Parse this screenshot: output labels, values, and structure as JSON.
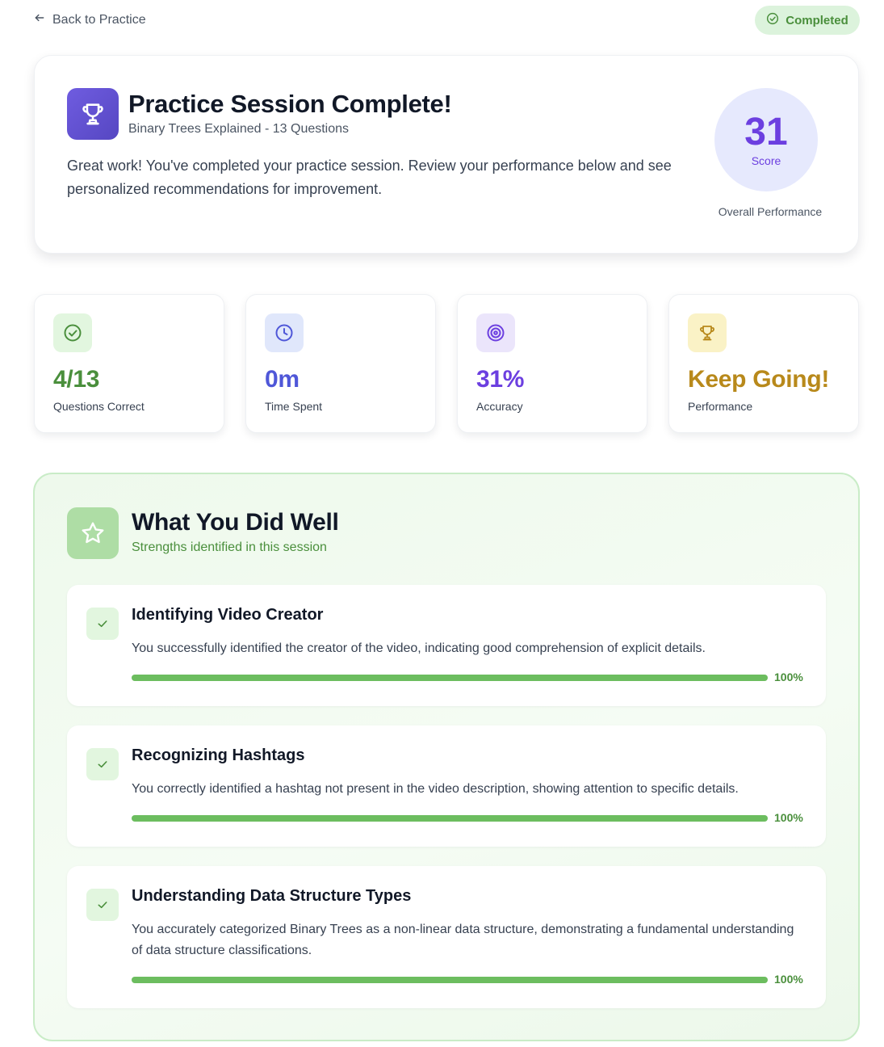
{
  "header": {
    "back_label": "Back to Practice",
    "back_icon": "arrow-left-icon",
    "status_label": "Completed",
    "status_icon": "check-circle-icon"
  },
  "hero": {
    "icon": "trophy-icon",
    "title": "Practice Session Complete!",
    "subtitle": "Binary Trees Explained - 13 Questions",
    "description": "Great work! You've completed your practice session. Review your performance below and see personalized recommendations for improvement.",
    "score_value": "31",
    "score_label": "Score",
    "score_caption": "Overall Performance"
  },
  "stats": [
    {
      "icon": "check-circle-icon",
      "value": "4/13",
      "label": "Questions Correct",
      "color": "#4a8f3c",
      "icon_bg": "#e2f6df"
    },
    {
      "icon": "clock-icon",
      "value": "0m",
      "label": "Time Spent",
      "color": "#4f57d8",
      "icon_bg": "#e0e7fb"
    },
    {
      "icon": "target-icon",
      "value": "31%",
      "label": "Accuracy",
      "color": "#6c3fe0",
      "icon_bg": "#ebe5fb"
    },
    {
      "icon": "trophy-icon",
      "value": "Keep Going!",
      "label": "Performance",
      "color": "#b8891b",
      "icon_bg": "#faf2c6"
    }
  ],
  "strengths": {
    "icon": "star-icon",
    "title": "What You Did Well",
    "subtitle": "Strengths identified in this session",
    "items": [
      {
        "title": "Identifying Video Creator",
        "description": "You successfully identified the creator of the video, indicating good comprehension of explicit details.",
        "progress": 100,
        "progress_label": "100%"
      },
      {
        "title": "Recognizing Hashtags",
        "description": "You correctly identified a hashtag not present in the video description, showing attention to specific details.",
        "progress": 100,
        "progress_label": "100%"
      },
      {
        "title": "Understanding Data Structure Types",
        "description": "You accurately categorized Binary Trees as a non-linear data structure, demonstrating a fundamental understanding of data structure classifications.",
        "progress": 100,
        "progress_label": "100%"
      }
    ]
  },
  "colors": {
    "accent_purple": "#6c3fe0",
    "success_green": "#4a8f3c",
    "progress_green": "#6cbd5f"
  }
}
